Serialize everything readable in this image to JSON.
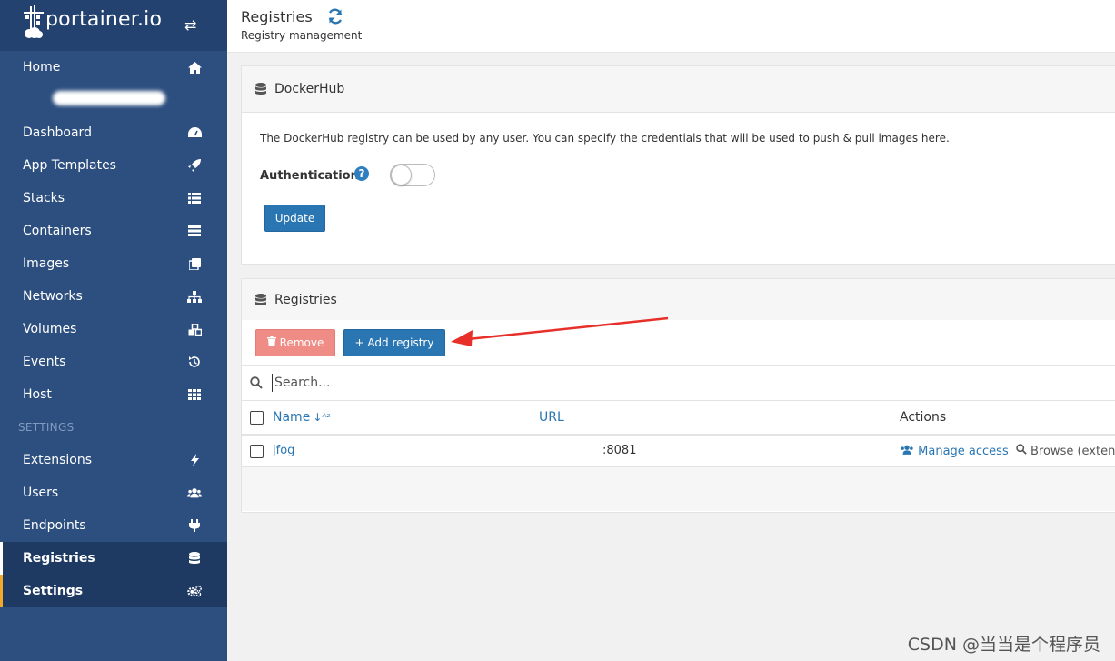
{
  "brand": {
    "name": "portainer.io"
  },
  "sidebar": {
    "home": "Home",
    "items": [
      {
        "label": "Dashboard",
        "icon": "tachometer-icon"
      },
      {
        "label": "App Templates",
        "icon": "rocket-icon"
      },
      {
        "label": "Stacks",
        "icon": "th-list-icon"
      },
      {
        "label": "Containers",
        "icon": "server-icon"
      },
      {
        "label": "Images",
        "icon": "clone-icon"
      },
      {
        "label": "Networks",
        "icon": "sitemap-icon"
      },
      {
        "label": "Volumes",
        "icon": "cubes-icon"
      },
      {
        "label": "Events",
        "icon": "history-icon"
      },
      {
        "label": "Host",
        "icon": "th-icon"
      }
    ],
    "settings_header": "SETTINGS",
    "settings_items": [
      {
        "label": "Extensions",
        "icon": "bolt-icon"
      },
      {
        "label": "Users",
        "icon": "users-icon"
      },
      {
        "label": "Endpoints",
        "icon": "plug-icon"
      },
      {
        "label": "Registries",
        "icon": "database-icon"
      },
      {
        "label": "Settings",
        "icon": "cogs-icon"
      }
    ]
  },
  "header": {
    "title": "Registries",
    "subtitle": "Registry management"
  },
  "dockerhub": {
    "title": "DockerHub",
    "description": "The DockerHub registry can be used by any user. You can specify the credentials that will be used to push & pull images here.",
    "auth_label": "Authentication",
    "auth_enabled": false,
    "update_label": "Update"
  },
  "registries": {
    "title": "Registries",
    "remove_label": "Remove",
    "add_label": "+ Add registry",
    "search_placeholder": "Search...",
    "columns": {
      "name": "Name",
      "url": "URL",
      "actions": "Actions"
    },
    "rows": [
      {
        "name": "jfog",
        "url": ":8081",
        "manage_access": "Manage access",
        "browse": "Browse (exten"
      }
    ]
  },
  "watermark": "CSDN @当当是个程序员",
  "colors": {
    "sidebar": "#2d4f7f",
    "primary": "#2a76b3",
    "danger": "#ee8c85",
    "accent": "#f0a92a",
    "arrow": "#e8302a"
  }
}
